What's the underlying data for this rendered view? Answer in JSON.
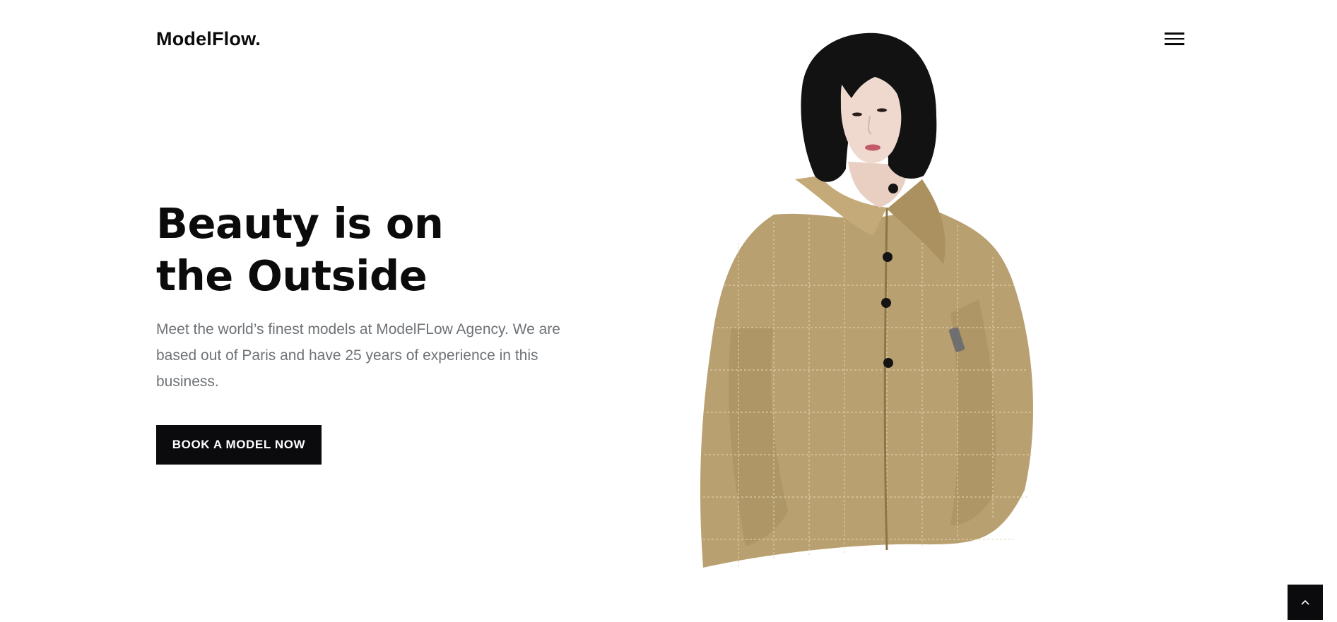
{
  "header": {
    "brand": "ModelFlow.",
    "menu_icon": "hamburger-menu-icon"
  },
  "hero": {
    "title_line_1": "Beauty is on",
    "title_line_2": "the Outside",
    "description": "Meet the world’s finest models at ModelFLow Agency. We are based out of Paris and have 25 years of experience in this business.",
    "cta_label": "BOOK A MODEL NOW"
  },
  "image": {
    "subject": "model-photo",
    "jacket_color": "#b9a070",
    "hair_color": "#121212",
    "skin_color": "#efd9cf"
  },
  "scroll_top": {
    "icon": "chevron-up-icon"
  },
  "colors": {
    "text_dark": "#0b0b0b",
    "text_muted": "#6e7377",
    "button_bg": "#0b0b0e",
    "button_text": "#ffffff",
    "background": "#ffffff"
  }
}
